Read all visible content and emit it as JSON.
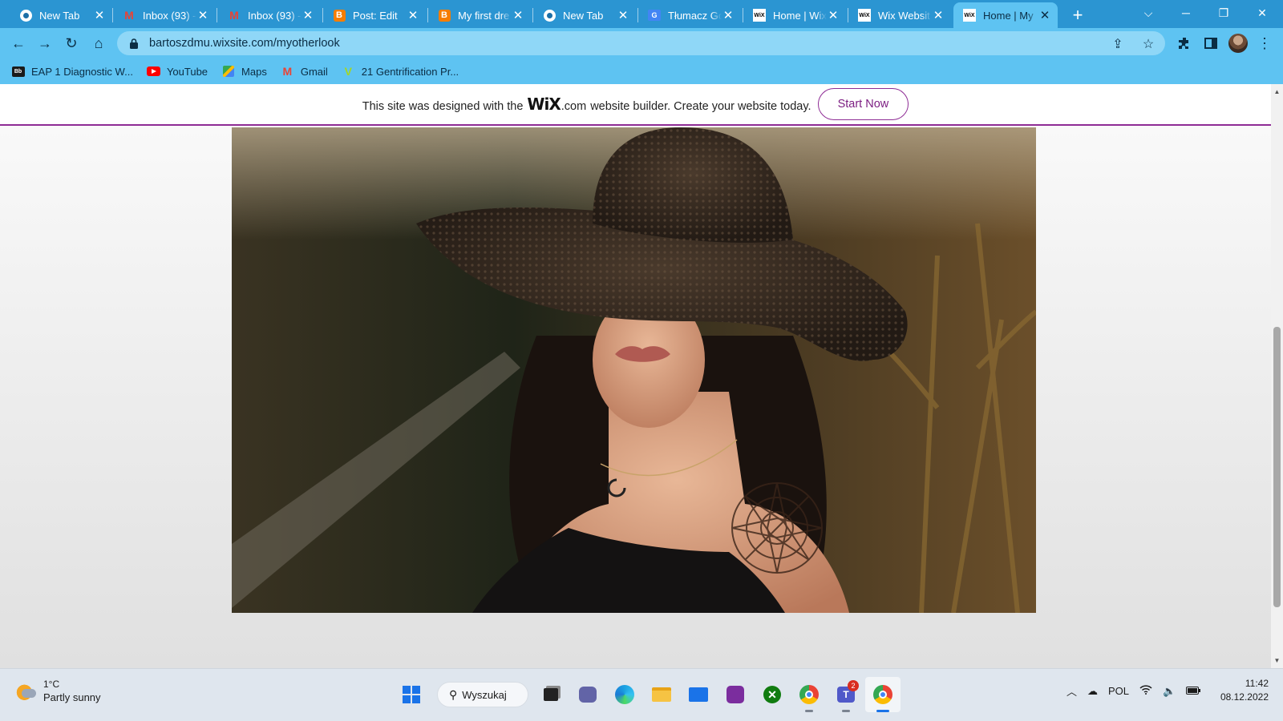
{
  "browser": {
    "tabs": [
      {
        "title": "New Tab",
        "icon": "chrome-icon",
        "active": false
      },
      {
        "title": "Inbox (93) -",
        "icon": "gmail-icon",
        "active": false
      },
      {
        "title": "Inbox (93) -",
        "icon": "gmail-icon",
        "active": false
      },
      {
        "title": "Post: Edit",
        "icon": "blogger-icon",
        "active": false
      },
      {
        "title": "My first dre",
        "icon": "blogger-icon",
        "active": false
      },
      {
        "title": "New Tab",
        "icon": "chrome-icon",
        "active": false
      },
      {
        "title": "Tłumacz Go",
        "icon": "google-translate-icon",
        "active": false
      },
      {
        "title": "Home | Wix",
        "icon": "wix-icon",
        "active": false
      },
      {
        "title": "Wix Websit",
        "icon": "wix-icon",
        "active": false
      },
      {
        "title": "Home | My",
        "icon": "wix-icon",
        "active": true
      }
    ],
    "address_bar": {
      "url": "bartoszdmu.wixsite.com/myotherlook"
    },
    "bookmarks": [
      {
        "label": "EAP 1 Diagnostic W...",
        "icon": "eap-icon"
      },
      {
        "label": "YouTube",
        "icon": "youtube-icon"
      },
      {
        "label": "Maps",
        "icon": "maps-icon"
      },
      {
        "label": "Gmail",
        "icon": "gmail-icon"
      },
      {
        "label": "21 Gentrification Pr...",
        "icon": "vocabulary-icon"
      }
    ]
  },
  "wix_banner": {
    "text_before": "This site was designed with the",
    "logo": "WiX",
    "dotcom": ".com",
    "text_after": "website builder. Create your website today.",
    "button": "Start Now",
    "accent_color": "#8e2c95"
  },
  "hero_image": {
    "description_icon": "photo-woman-in-wide-brim-hat"
  },
  "taskbar": {
    "weather": {
      "temp": "1°C",
      "desc": "Partly sunny"
    },
    "search_label": "Wyszukaj",
    "teams_badge": "2",
    "tray": {
      "language": "POL"
    },
    "clock": {
      "time": "11:42",
      "date": "08.12.2022"
    }
  }
}
